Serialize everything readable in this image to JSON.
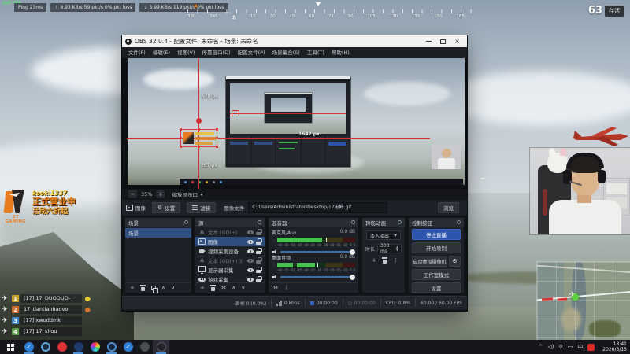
{
  "hud": {
    "fps_counter": "110 FPS",
    "ping": "Ping 23ms",
    "net_up": "8.93 KB/s  59 pkt/s  0% pkt loss",
    "net_down": "3.99 KB/s  119 pkt/s  0% pkt loss",
    "alive_count": "63",
    "alive_label": "存活",
    "compass_labels": [
      "330",
      "345",
      "北",
      "15",
      "30",
      "45",
      "60",
      "75",
      "90",
      "105",
      "120",
      "135",
      "150",
      "165"
    ]
  },
  "promo": {
    "brand": "17 GAMING",
    "line1": "kook:1337",
    "line2": "正式营业中",
    "line3": "活动六折起"
  },
  "team": {
    "rows": [
      {
        "num": "1",
        "name": "[17] 17_DUODUO-_"
      },
      {
        "num": "2",
        "name": "17_tiantianhaovo"
      },
      {
        "num": "3",
        "name": "[17] xwuddmk"
      },
      {
        "num": "4",
        "name": "[17] 17_shou"
      }
    ]
  },
  "obs": {
    "title": "OBS 32.0.4 - 配置文件: 未命名 - 场景: 未命名",
    "close_glyph": "×",
    "menus": [
      "文件(F)",
      "编辑(E)",
      "视图(V)",
      "停靠窗口(D)",
      "配置文件(P)",
      "场景集合(S)",
      "工具(T)",
      "帮助(H)"
    ],
    "preview": {
      "guide_top": "670 px",
      "guide_right": "1642 px",
      "guide_bottom": "367 px",
      "zoom_value": "35%",
      "zoom_mode": "缩放显示口"
    },
    "properties": {
      "source_type": "图像",
      "settings": "设置",
      "filters": "滤镜",
      "file_label": "图像文件",
      "file_path": "C:/Users/Administrator/Desktop/17电鳗.gif",
      "browse": "浏览"
    },
    "scenes": {
      "title": "场景",
      "items": [
        {
          "label": "场景"
        }
      ]
    },
    "sources": {
      "title": "源",
      "items": [
        {
          "label": "文本 (GDI+)"
        },
        {
          "label": "图像"
        },
        {
          "label": "视频采集设备"
        },
        {
          "label": "文本 (GDI+) 3"
        },
        {
          "label": "显示器采集"
        },
        {
          "label": "游戏采集"
        }
      ]
    },
    "mixer": {
      "title": "混音器",
      "channels": [
        {
          "name": "麦克风/Aux",
          "db": "0.0 dB"
        },
        {
          "name": "桌面音频",
          "db": "0.0 dB"
        }
      ],
      "ticks": [
        "-60",
        "-55",
        "-50",
        "-45",
        "-40",
        "-35",
        "-30",
        "-25",
        "-20",
        "-15",
        "-10",
        "-5",
        "0"
      ]
    },
    "transitions": {
      "title": "转场动画",
      "type": "淡入淡出",
      "duration_label": "时长",
      "duration": "300 ms"
    },
    "controls": {
      "title": "控制按钮",
      "stop_stream": "停止直播",
      "start_record": "开始录制",
      "virtual_cam": "启动虚拟摄像机",
      "studio_mode": "工作室模式",
      "settings": "设置"
    },
    "status": {
      "dropped": "丢帧 0 (0.0%)",
      "bitrate": "0 kbps",
      "stream_time": "00:00:00",
      "record_time": "00:00:00",
      "cpu": "CPU: 0.8%",
      "fps": "60.00 / 60.00 FPS"
    }
  },
  "taskbar": {
    "ime": "中",
    "time": "18:41",
    "date": "2026/3/13"
  },
  "colors": {
    "accent_blue": "#2d54ad",
    "selection_red": "#e03a3a",
    "meter_green": "#46c24f",
    "brand_orange": "#e87c1e"
  }
}
